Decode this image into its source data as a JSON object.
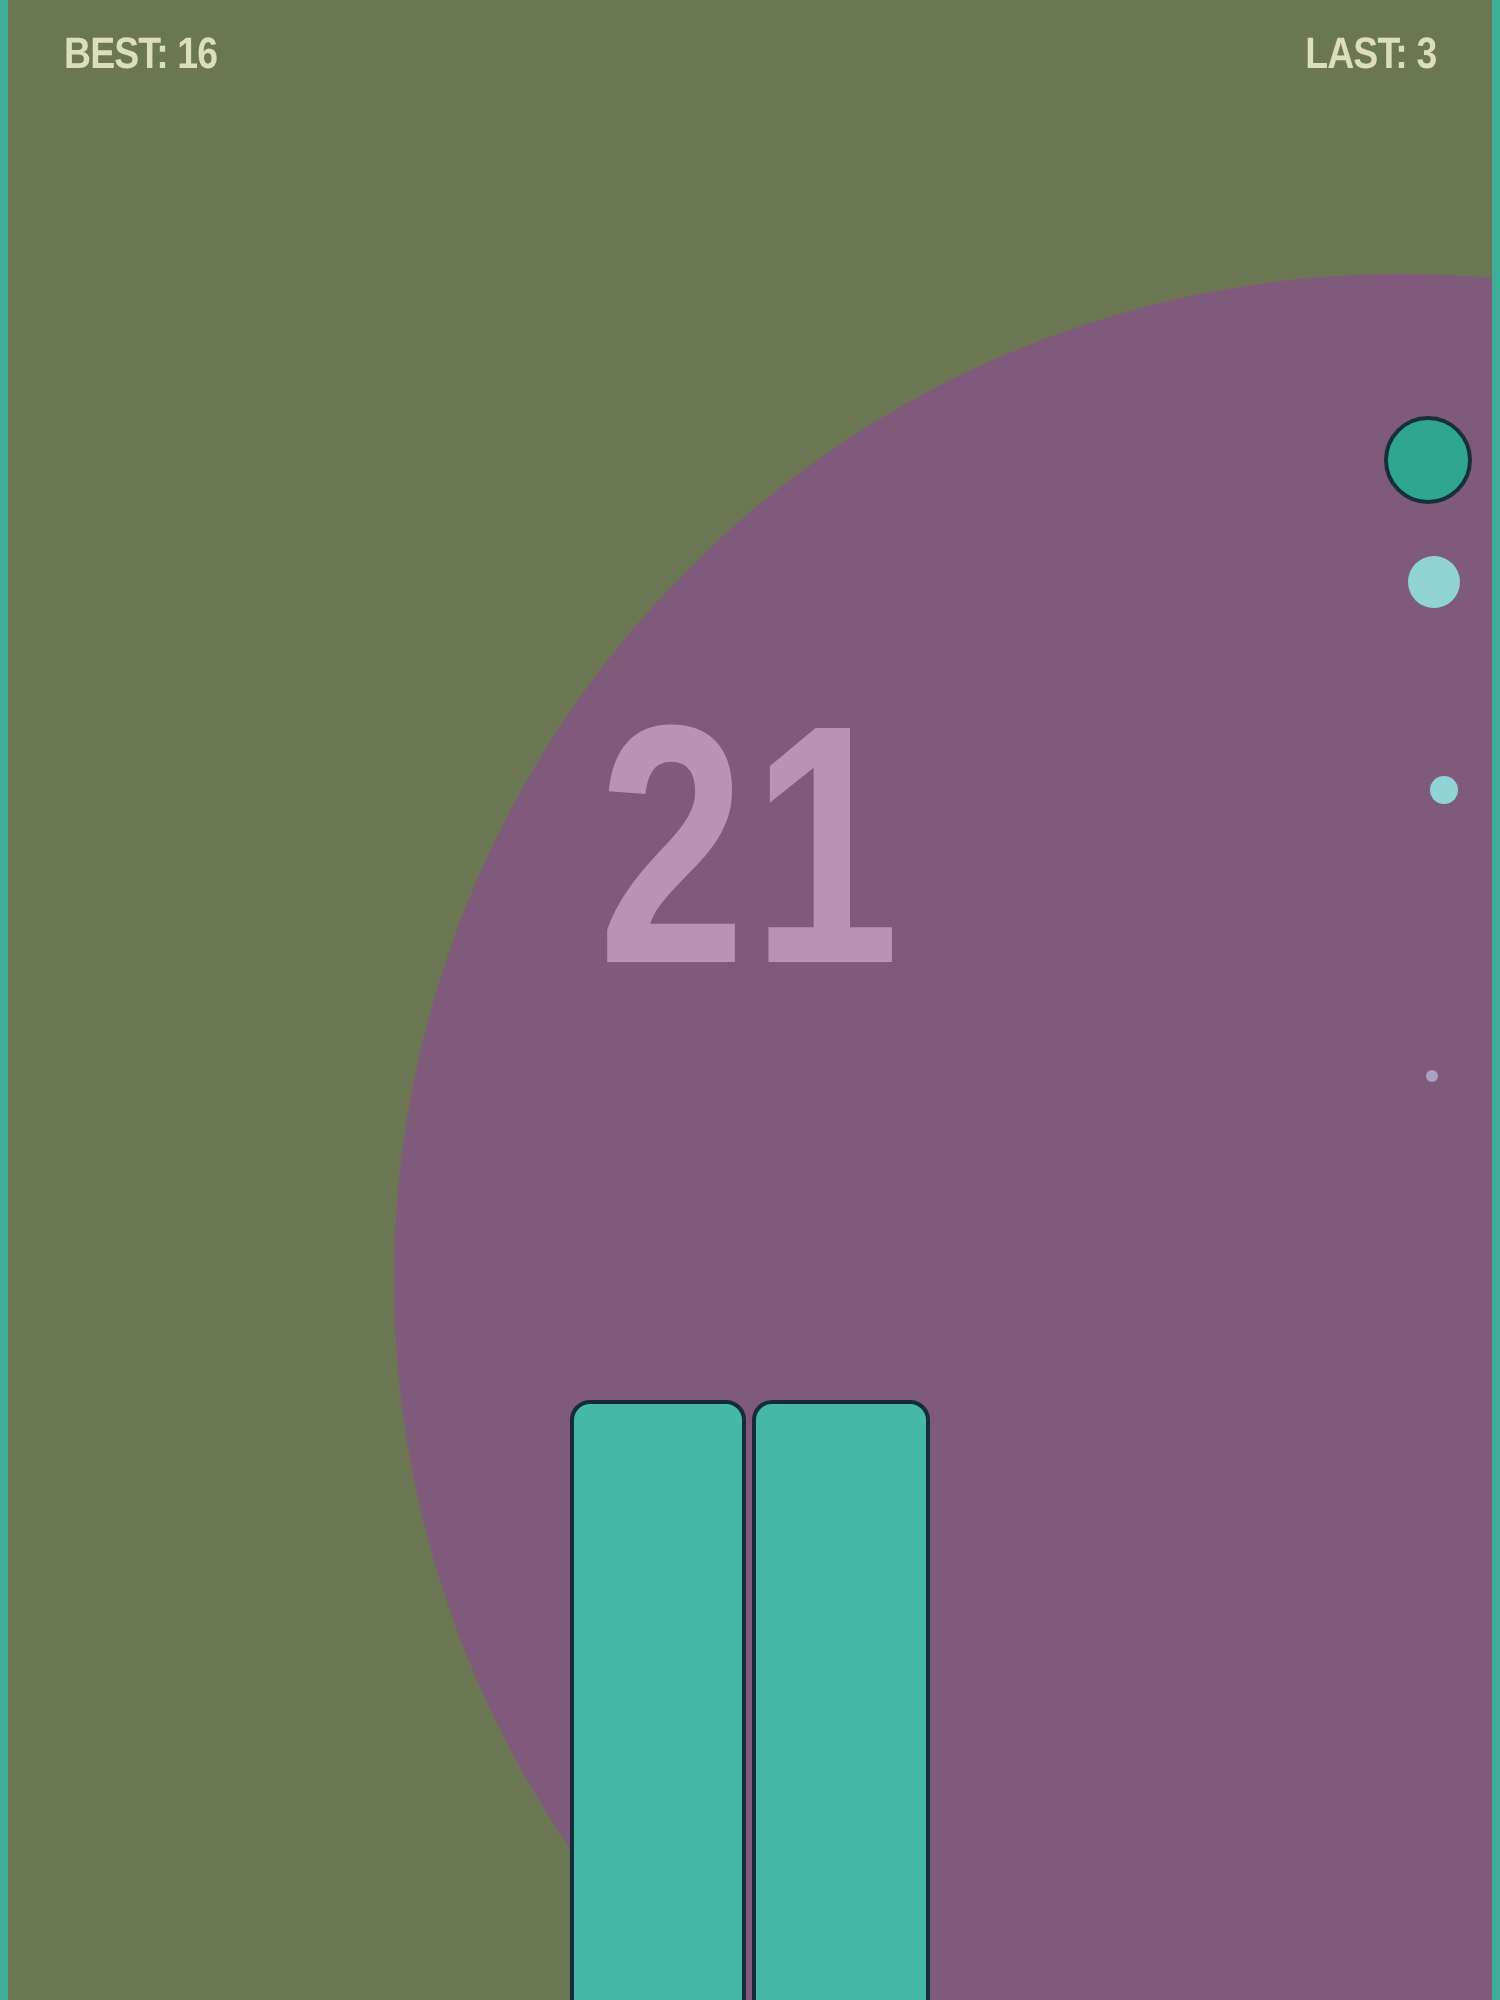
{
  "hud": {
    "best": "BEST: 16",
    "last": "LAST: 3"
  },
  "score": "21"
}
